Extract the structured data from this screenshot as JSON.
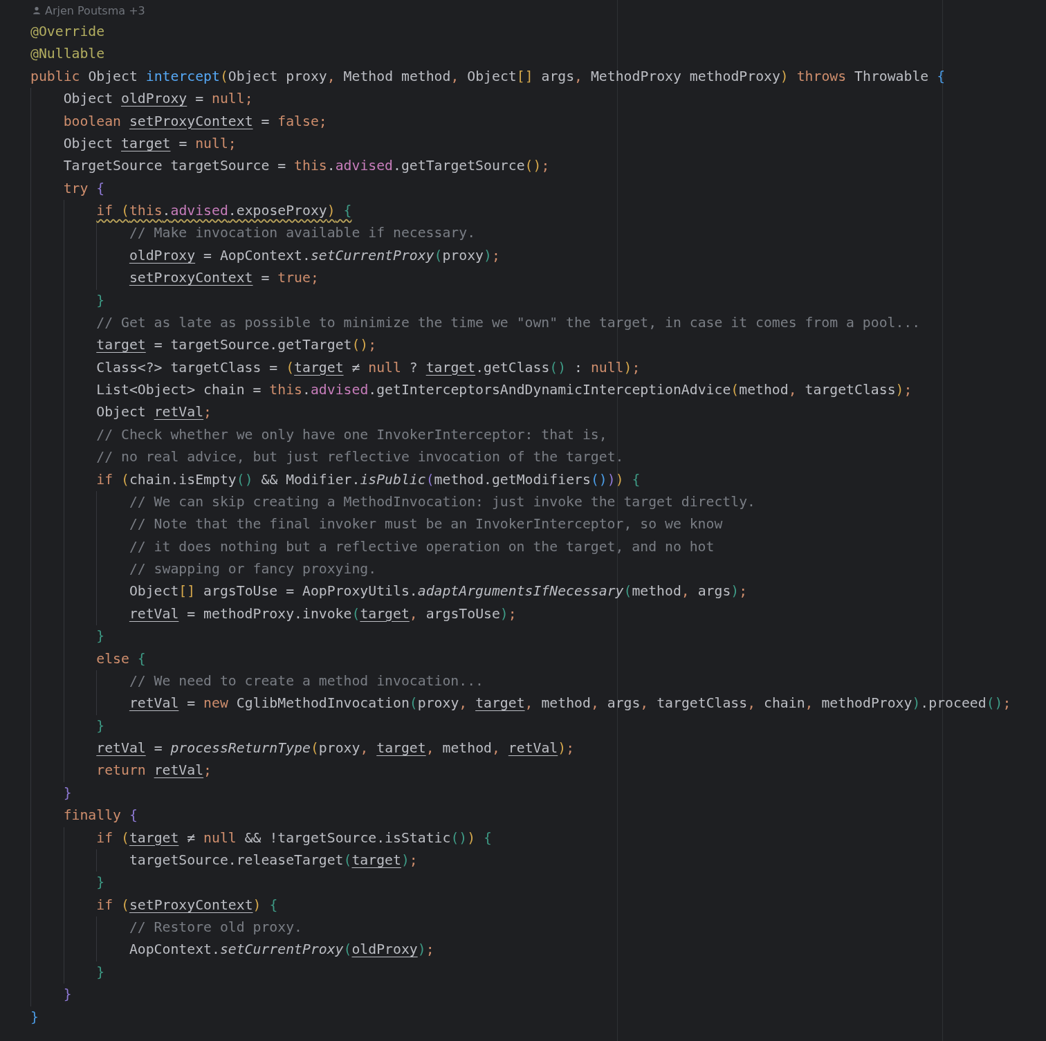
{
  "author_hint": {
    "text": "Arjen Poutsma +3"
  },
  "code": {
    "lines": [
      {
        "tokens": [
          {
            "t": "@Override",
            "kind": "ann"
          }
        ]
      },
      {
        "tokens": [
          {
            "t": "@Nullable",
            "kind": "ann"
          }
        ]
      },
      {
        "tokens": [
          {
            "t": "public ",
            "kind": "kw"
          },
          {
            "t": "Object ",
            "kind": "p"
          },
          {
            "t": "intercept",
            "kind": "fn"
          },
          {
            "t": "(",
            "kind": "br",
            "color": "#d5a84c"
          },
          {
            "t": "Object proxy",
            "kind": "p"
          },
          {
            "t": ",",
            "kind": "op"
          },
          {
            "t": " Method method",
            "kind": "p"
          },
          {
            "t": ",",
            "kind": "op"
          },
          {
            "t": " Object",
            "kind": "p"
          },
          {
            "t": "[]",
            "kind": "br",
            "color": "#d5a84c"
          },
          {
            "t": " args",
            "kind": "p"
          },
          {
            "t": ",",
            "kind": "op"
          },
          {
            "t": " MethodProxy methodProxy",
            "kind": "p"
          },
          {
            "t": ")",
            "kind": "br",
            "color": "#d5a84c"
          },
          {
            "t": " throws ",
            "kind": "kw"
          },
          {
            "t": "Throwable ",
            "kind": "p"
          },
          {
            "t": "{",
            "kind": "br",
            "color": "#4b9ce6"
          }
        ],
        "children": [
          {
            "tokens": [
              {
                "t": "Object ",
                "kind": "p"
              },
              {
                "t": "oldProxy",
                "kind": "u"
              },
              {
                "t": " = ",
                "kind": "p"
              },
              {
                "t": "null",
                "kind": "kw"
              },
              {
                "t": ";",
                "kind": "op"
              }
            ]
          },
          {
            "tokens": [
              {
                "t": "boolean ",
                "kind": "kw"
              },
              {
                "t": "setProxyContext",
                "kind": "u"
              },
              {
                "t": " = ",
                "kind": "p"
              },
              {
                "t": "false",
                "kind": "kw"
              },
              {
                "t": ";",
                "kind": "op"
              }
            ]
          },
          {
            "tokens": [
              {
                "t": "Object ",
                "kind": "p"
              },
              {
                "t": "target",
                "kind": "u"
              },
              {
                "t": " = ",
                "kind": "p"
              },
              {
                "t": "null",
                "kind": "kw"
              },
              {
                "t": ";",
                "kind": "op"
              }
            ]
          },
          {
            "tokens": [
              {
                "t": "TargetSource targetSource = ",
                "kind": "p"
              },
              {
                "t": "this",
                "kind": "kw"
              },
              {
                "t": ".",
                "kind": "p"
              },
              {
                "t": "advised",
                "kind": "fd"
              },
              {
                "t": ".getTargetSource",
                "kind": "p"
              },
              {
                "t": "()",
                "kind": "br",
                "color": "#d5a84c"
              },
              {
                "t": ";",
                "kind": "op"
              }
            ]
          },
          {
            "tokens": [
              {
                "t": "try ",
                "kind": "kw"
              },
              {
                "t": "{",
                "kind": "br",
                "color": "#8f7ad6"
              }
            ],
            "children": [
              {
                "warning": true,
                "tokens": [
                  {
                    "t": "if ",
                    "kind": "kw"
                  },
                  {
                    "t": "(",
                    "kind": "br",
                    "color": "#d5a84c"
                  },
                  {
                    "t": "this",
                    "kind": "kw"
                  },
                  {
                    "t": ".",
                    "kind": "p"
                  },
                  {
                    "t": "advised",
                    "kind": "fd"
                  },
                  {
                    "t": ".exposeProxy",
                    "kind": "p"
                  },
                  {
                    "t": ")",
                    "kind": "br",
                    "color": "#d5a84c"
                  },
                  {
                    "t": " {",
                    "kind": "br",
                    "color": "#3e9b86"
                  }
                ],
                "children": [
                  {
                    "tokens": [
                      {
                        "t": "// Make invocation available if necessary.",
                        "kind": "cm"
                      }
                    ]
                  },
                  {
                    "tokens": [
                      {
                        "t": "oldProxy",
                        "kind": "u"
                      },
                      {
                        "t": " = AopContext.",
                        "kind": "p"
                      },
                      {
                        "t": "setCurrentProxy",
                        "kind": "it"
                      },
                      {
                        "t": "(",
                        "kind": "br",
                        "color": "#3e9b86"
                      },
                      {
                        "t": "proxy",
                        "kind": "p"
                      },
                      {
                        "t": ")",
                        "kind": "br",
                        "color": "#3e9b86"
                      },
                      {
                        "t": ";",
                        "kind": "op"
                      }
                    ]
                  },
                  {
                    "tokens": [
                      {
                        "t": "setProxyContext",
                        "kind": "u"
                      },
                      {
                        "t": " = ",
                        "kind": "p"
                      },
                      {
                        "t": "true",
                        "kind": "kw"
                      },
                      {
                        "t": ";",
                        "kind": "op"
                      }
                    ]
                  }
                ]
              },
              {
                "tokens": [
                  {
                    "t": "}",
                    "kind": "br",
                    "color": "#3e9b86"
                  }
                ]
              },
              {
                "tokens": [
                  {
                    "t": "// Get as late as possible to minimize the time we \"own\" the target, in case it comes from a pool...",
                    "kind": "cm"
                  }
                ]
              },
              {
                "tokens": [
                  {
                    "t": "target",
                    "kind": "u"
                  },
                  {
                    "t": " = targetSource.getTarget",
                    "kind": "p"
                  },
                  {
                    "t": "()",
                    "kind": "br",
                    "color": "#d5a84c"
                  },
                  {
                    "t": ";",
                    "kind": "op"
                  }
                ]
              },
              {
                "tokens": [
                  {
                    "t": "Class<?> targetClass = ",
                    "kind": "p"
                  },
                  {
                    "t": "(",
                    "kind": "br",
                    "color": "#d5a84c"
                  },
                  {
                    "t": "target",
                    "kind": "u"
                  },
                  {
                    "t": " ≠ ",
                    "kind": "p"
                  },
                  {
                    "t": "null",
                    "kind": "kw"
                  },
                  {
                    "t": " ? ",
                    "kind": "p"
                  },
                  {
                    "t": "target",
                    "kind": "u"
                  },
                  {
                    "t": ".getClass",
                    "kind": "p"
                  },
                  {
                    "t": "()",
                    "kind": "br",
                    "color": "#3e9b86"
                  },
                  {
                    "t": " : ",
                    "kind": "p"
                  },
                  {
                    "t": "null",
                    "kind": "kw"
                  },
                  {
                    "t": ")",
                    "kind": "br",
                    "color": "#d5a84c"
                  },
                  {
                    "t": ";",
                    "kind": "op"
                  }
                ]
              },
              {
                "tokens": [
                  {
                    "t": "List<Object> chain = ",
                    "kind": "p"
                  },
                  {
                    "t": "this",
                    "kind": "kw"
                  },
                  {
                    "t": ".",
                    "kind": "p"
                  },
                  {
                    "t": "advised",
                    "kind": "fd"
                  },
                  {
                    "t": ".getInterceptorsAndDynamicInterceptionAdvice",
                    "kind": "p"
                  },
                  {
                    "t": "(",
                    "kind": "br",
                    "color": "#d5a84c"
                  },
                  {
                    "t": "method",
                    "kind": "p"
                  },
                  {
                    "t": ",",
                    "kind": "op"
                  },
                  {
                    "t": " targetClass",
                    "kind": "p"
                  },
                  {
                    "t": ")",
                    "kind": "br",
                    "color": "#d5a84c"
                  },
                  {
                    "t": ";",
                    "kind": "op"
                  }
                ]
              },
              {
                "tokens": [
                  {
                    "t": "Object ",
                    "kind": "p"
                  },
                  {
                    "t": "retVal",
                    "kind": "u"
                  },
                  {
                    "t": ";",
                    "kind": "op"
                  }
                ]
              },
              {
                "tokens": [
                  {
                    "t": "// Check whether we only have one InvokerInterceptor: that is,",
                    "kind": "cm"
                  }
                ]
              },
              {
                "tokens": [
                  {
                    "t": "// no real advice, but just reflective invocation of the target.",
                    "kind": "cm"
                  }
                ]
              },
              {
                "tokens": [
                  {
                    "t": "if ",
                    "kind": "kw"
                  },
                  {
                    "t": "(",
                    "kind": "br",
                    "color": "#d5a84c"
                  },
                  {
                    "t": "chain.isEmpty",
                    "kind": "p"
                  },
                  {
                    "t": "()",
                    "kind": "br",
                    "color": "#3e9b86"
                  },
                  {
                    "t": " && Modifier.",
                    "kind": "p"
                  },
                  {
                    "t": "isPublic",
                    "kind": "it"
                  },
                  {
                    "t": "(",
                    "kind": "br",
                    "color": "#8f7ad6"
                  },
                  {
                    "t": "method.getModifiers",
                    "kind": "p"
                  },
                  {
                    "t": "()",
                    "kind": "br",
                    "color": "#4b9ce6"
                  },
                  {
                    "t": ")",
                    "kind": "br",
                    "color": "#8f7ad6"
                  },
                  {
                    "t": ")",
                    "kind": "br",
                    "color": "#d5a84c"
                  },
                  {
                    "t": " {",
                    "kind": "br",
                    "color": "#3e9b86"
                  }
                ],
                "children": [
                  {
                    "tokens": [
                      {
                        "t": "// We can skip creating a MethodInvocation: just invoke the target directly.",
                        "kind": "cm"
                      }
                    ]
                  },
                  {
                    "tokens": [
                      {
                        "t": "// Note that the final invoker must be an InvokerInterceptor, so we know",
                        "kind": "cm"
                      }
                    ]
                  },
                  {
                    "tokens": [
                      {
                        "t": "// it does nothing but a reflective operation on the target, and no hot",
                        "kind": "cm"
                      }
                    ]
                  },
                  {
                    "tokens": [
                      {
                        "t": "// swapping or fancy proxying.",
                        "kind": "cm"
                      }
                    ]
                  },
                  {
                    "tokens": [
                      {
                        "t": "Object",
                        "kind": "p"
                      },
                      {
                        "t": "[]",
                        "kind": "br",
                        "color": "#d5a84c"
                      },
                      {
                        "t": " argsToUse = AopProxyUtils.",
                        "kind": "p"
                      },
                      {
                        "t": "adaptArgumentsIfNecessary",
                        "kind": "it"
                      },
                      {
                        "t": "(",
                        "kind": "br",
                        "color": "#3e9b86"
                      },
                      {
                        "t": "method",
                        "kind": "p"
                      },
                      {
                        "t": ",",
                        "kind": "op"
                      },
                      {
                        "t": " args",
                        "kind": "p"
                      },
                      {
                        "t": ")",
                        "kind": "br",
                        "color": "#3e9b86"
                      },
                      {
                        "t": ";",
                        "kind": "op"
                      }
                    ]
                  },
                  {
                    "tokens": [
                      {
                        "t": "retVal",
                        "kind": "u"
                      },
                      {
                        "t": " = methodProxy.invoke",
                        "kind": "p"
                      },
                      {
                        "t": "(",
                        "kind": "br",
                        "color": "#3e9b86"
                      },
                      {
                        "t": "target",
                        "kind": "u"
                      },
                      {
                        "t": ",",
                        "kind": "op"
                      },
                      {
                        "t": " argsToUse",
                        "kind": "p"
                      },
                      {
                        "t": ")",
                        "kind": "br",
                        "color": "#3e9b86"
                      },
                      {
                        "t": ";",
                        "kind": "op"
                      }
                    ]
                  }
                ]
              },
              {
                "tokens": [
                  {
                    "t": "}",
                    "kind": "br",
                    "color": "#3e9b86"
                  }
                ]
              },
              {
                "tokens": [
                  {
                    "t": "else ",
                    "kind": "kw"
                  },
                  {
                    "t": "{",
                    "kind": "br",
                    "color": "#3e9b86"
                  }
                ],
                "children": [
                  {
                    "tokens": [
                      {
                        "t": "// We need to create a method invocation...",
                        "kind": "cm"
                      }
                    ]
                  },
                  {
                    "tokens": [
                      {
                        "t": "retVal",
                        "kind": "u"
                      },
                      {
                        "t": " = ",
                        "kind": "p"
                      },
                      {
                        "t": "new ",
                        "kind": "kw"
                      },
                      {
                        "t": "CglibMethodInvocation",
                        "kind": "p"
                      },
                      {
                        "t": "(",
                        "kind": "br",
                        "color": "#3e9b86"
                      },
                      {
                        "t": "proxy",
                        "kind": "p"
                      },
                      {
                        "t": ", ",
                        "kind": "op"
                      },
                      {
                        "t": "target",
                        "kind": "u"
                      },
                      {
                        "t": ",",
                        "kind": "op"
                      },
                      {
                        "t": " method",
                        "kind": "p"
                      },
                      {
                        "t": ",",
                        "kind": "op"
                      },
                      {
                        "t": " args",
                        "kind": "p"
                      },
                      {
                        "t": ",",
                        "kind": "op"
                      },
                      {
                        "t": " targetClass",
                        "kind": "p"
                      },
                      {
                        "t": ",",
                        "kind": "op"
                      },
                      {
                        "t": " chain",
                        "kind": "p"
                      },
                      {
                        "t": ",",
                        "kind": "op"
                      },
                      {
                        "t": " methodProxy",
                        "kind": "p"
                      },
                      {
                        "t": ")",
                        "kind": "br",
                        "color": "#3e9b86"
                      },
                      {
                        "t": ".proceed",
                        "kind": "p"
                      },
                      {
                        "t": "()",
                        "kind": "br",
                        "color": "#3e9b86"
                      },
                      {
                        "t": ";",
                        "kind": "op"
                      }
                    ]
                  }
                ]
              },
              {
                "tokens": [
                  {
                    "t": "}",
                    "kind": "br",
                    "color": "#3e9b86"
                  }
                ]
              },
              {
                "tokens": [
                  {
                    "t": "retVal",
                    "kind": "u"
                  },
                  {
                    "t": " = ",
                    "kind": "p"
                  },
                  {
                    "t": "processReturnType",
                    "kind": "it"
                  },
                  {
                    "t": "(",
                    "kind": "br",
                    "color": "#d5a84c"
                  },
                  {
                    "t": "proxy",
                    "kind": "p"
                  },
                  {
                    "t": ", ",
                    "kind": "op"
                  },
                  {
                    "t": "target",
                    "kind": "u"
                  },
                  {
                    "t": ",",
                    "kind": "op"
                  },
                  {
                    "t": " method",
                    "kind": "p"
                  },
                  {
                    "t": ", ",
                    "kind": "op"
                  },
                  {
                    "t": "retVal",
                    "kind": "u"
                  },
                  {
                    "t": ")",
                    "kind": "br",
                    "color": "#d5a84c"
                  },
                  {
                    "t": ";",
                    "kind": "op"
                  }
                ]
              },
              {
                "tokens": [
                  {
                    "t": "return ",
                    "kind": "kw"
                  },
                  {
                    "t": "retVal",
                    "kind": "u"
                  },
                  {
                    "t": ";",
                    "kind": "op"
                  }
                ]
              }
            ]
          },
          {
            "tokens": [
              {
                "t": "}",
                "kind": "br",
                "color": "#8f7ad6"
              }
            ]
          },
          {
            "tokens": [
              {
                "t": "finally ",
                "kind": "kw"
              },
              {
                "t": "{",
                "kind": "br",
                "color": "#8f7ad6"
              }
            ],
            "children": [
              {
                "tokens": [
                  {
                    "t": "if ",
                    "kind": "kw"
                  },
                  {
                    "t": "(",
                    "kind": "br",
                    "color": "#d5a84c"
                  },
                  {
                    "t": "target",
                    "kind": "u"
                  },
                  {
                    "t": " ≠ ",
                    "kind": "p"
                  },
                  {
                    "t": "null",
                    "kind": "kw"
                  },
                  {
                    "t": " && !targetSource.isStatic",
                    "kind": "p"
                  },
                  {
                    "t": "()",
                    "kind": "br",
                    "color": "#3e9b86"
                  },
                  {
                    "t": ")",
                    "kind": "br",
                    "color": "#d5a84c"
                  },
                  {
                    "t": " {",
                    "kind": "br",
                    "color": "#3e9b86"
                  }
                ],
                "children": [
                  {
                    "tokens": [
                      {
                        "t": "targetSource.releaseTarget",
                        "kind": "p"
                      },
                      {
                        "t": "(",
                        "kind": "br",
                        "color": "#3e9b86"
                      },
                      {
                        "t": "target",
                        "kind": "u"
                      },
                      {
                        "t": ")",
                        "kind": "br",
                        "color": "#3e9b86"
                      },
                      {
                        "t": ";",
                        "kind": "op"
                      }
                    ]
                  }
                ]
              },
              {
                "tokens": [
                  {
                    "t": "}",
                    "kind": "br",
                    "color": "#3e9b86"
                  }
                ]
              },
              {
                "tokens": [
                  {
                    "t": "if ",
                    "kind": "kw"
                  },
                  {
                    "t": "(",
                    "kind": "br",
                    "color": "#d5a84c"
                  },
                  {
                    "t": "setProxyContext",
                    "kind": "u"
                  },
                  {
                    "t": ")",
                    "kind": "br",
                    "color": "#d5a84c"
                  },
                  {
                    "t": " {",
                    "kind": "br",
                    "color": "#3e9b86"
                  }
                ],
                "children": [
                  {
                    "tokens": [
                      {
                        "t": "// Restore old proxy.",
                        "kind": "cm"
                      }
                    ]
                  },
                  {
                    "tokens": [
                      {
                        "t": "AopContext.",
                        "kind": "p"
                      },
                      {
                        "t": "setCurrentProxy",
                        "kind": "it"
                      },
                      {
                        "t": "(",
                        "kind": "br",
                        "color": "#3e9b86"
                      },
                      {
                        "t": "oldProxy",
                        "kind": "u"
                      },
                      {
                        "t": ")",
                        "kind": "br",
                        "color": "#3e9b86"
                      },
                      {
                        "t": ";",
                        "kind": "op"
                      }
                    ]
                  }
                ]
              },
              {
                "tokens": [
                  {
                    "t": "}",
                    "kind": "br",
                    "color": "#3e9b86"
                  }
                ]
              }
            ]
          },
          {
            "tokens": [
              {
                "t": "}",
                "kind": "br",
                "color": "#8f7ad6"
              }
            ]
          }
        ]
      },
      {
        "tokens": [
          {
            "t": "}",
            "kind": "br",
            "color": "#4b9ce6"
          }
        ]
      }
    ]
  }
}
